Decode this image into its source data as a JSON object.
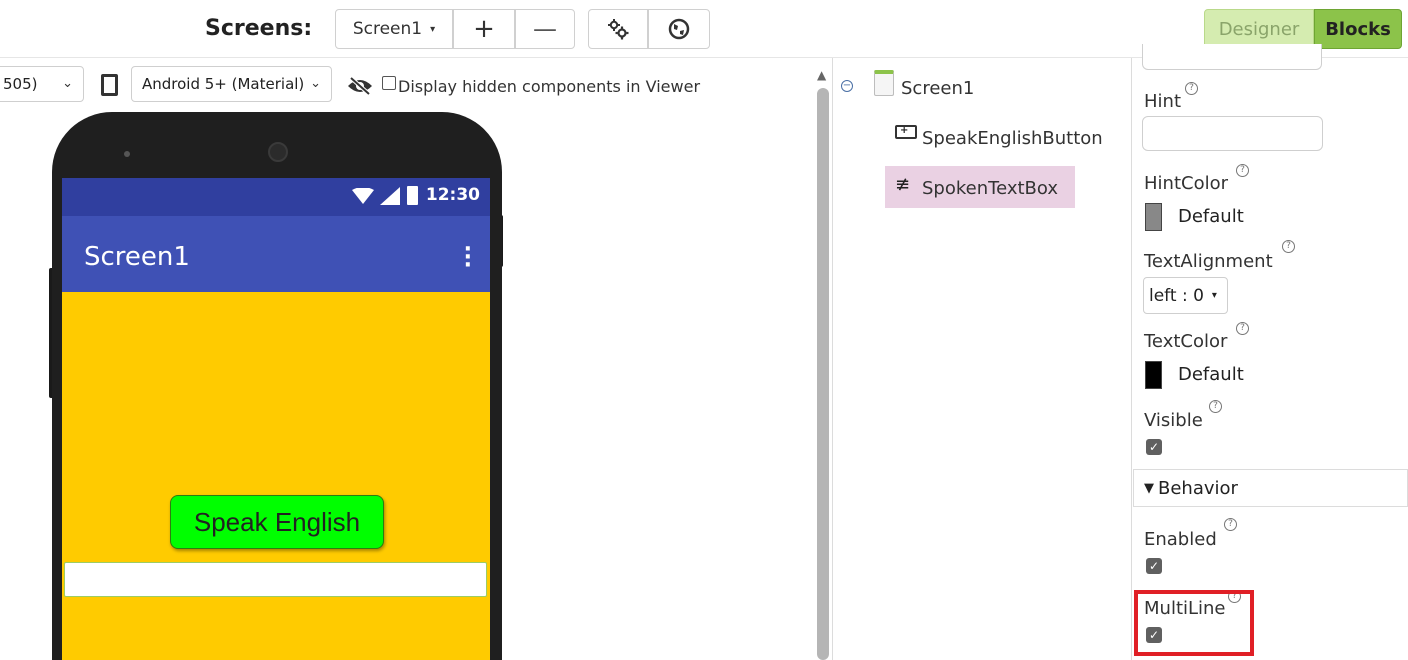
{
  "toolbar": {
    "screens_label": "Screens:",
    "screen_dropdown": "Screen1",
    "add_screen": "+",
    "remove_screen": "—",
    "designer_label": "Designer",
    "blocks_label": "Blocks"
  },
  "viewer": {
    "size_select": "505)",
    "theme_select": "Android 5+ (Material)",
    "hidden_components_label": "Display hidden components in Viewer",
    "hidden_components_checked": false
  },
  "phone": {
    "clock": "12:30",
    "app_title": "Screen1",
    "button_text": "Speak English",
    "background_color": "#ffcb00",
    "appbar_color": "#3f51b5",
    "statusbar_color": "#303f9f",
    "button_color": "#00ff00"
  },
  "tree": {
    "root": "Screen1",
    "items": [
      {
        "label": "SpeakEnglishButton",
        "type": "button"
      },
      {
        "label": "SpokenTextBox",
        "type": "textbox",
        "selected": true
      }
    ]
  },
  "properties": {
    "hint_label": "Hint",
    "hint_value": "",
    "hintcolor_label": "HintColor",
    "hintcolor_value": "Default",
    "hintcolor_swatch": "#888888",
    "textalignment_label": "TextAlignment",
    "textalignment_value": "left : 0",
    "textcolor_label": "TextColor",
    "textcolor_value": "Default",
    "textcolor_swatch": "#000000",
    "visible_label": "Visible",
    "visible_checked": true,
    "behavior_header": "Behavior",
    "enabled_label": "Enabled",
    "enabled_checked": true,
    "multiline_label": "MultiLine",
    "multiline_checked": true,
    "highlight_color": "#e01f26"
  }
}
